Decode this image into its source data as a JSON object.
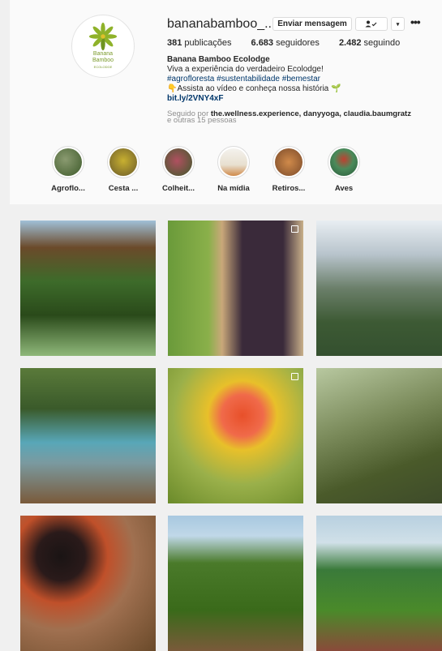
{
  "profile": {
    "username": "bananabamboo_...",
    "logo": {
      "line1": "Banana",
      "line2": "Bamboo",
      "sub": "ECOLODGE"
    },
    "buttons": {
      "message": "Enviar mensagem",
      "follow_icon": "person-check-icon",
      "caret": "▾",
      "more": "•••"
    },
    "stats": [
      {
        "count": "381",
        "label": "publicações"
      },
      {
        "count": "6.683",
        "label": "seguidores"
      },
      {
        "count": "2.482",
        "label": "seguindo"
      }
    ],
    "bio": {
      "name": "Banana Bamboo Ecolodge",
      "line1": "Viva a experiência do verdadeiro Ecolodge!",
      "tags": "#agrofloresta #sustentabilidade #bemestar",
      "line3": "👇Assista ao vídeo e conheça nossa história 🌱",
      "link": "bit.ly/2VNY4xF"
    },
    "followed_by": {
      "prefix": "Seguido por",
      "names": "the.wellness.experience, danyyoga, claudia.baumgratz",
      "suffix": "e outras 15 pessoas"
    }
  },
  "highlights": [
    {
      "label": "Agroflo...",
      "color": "#4d6b3c"
    },
    {
      "label": "Cesta ...",
      "color": "#8a7a2a"
    },
    {
      "label": "Colheit...",
      "color": "#8c3b4a"
    },
    {
      "label": "Na mídia",
      "color": "#e8e4dc"
    },
    {
      "label": "Retiros...",
      "color": "#b06a3a"
    },
    {
      "label": "Aves",
      "color": "#3f7a4a"
    }
  ],
  "posts": [
    {
      "name": "post-treehouse",
      "colors": [
        "#6b4a2a",
        "#3d6b2a",
        "#8fb87a"
      ]
    },
    {
      "name": "post-bananas-tart",
      "colors": [
        "#7aa04a",
        "#3a2a3a",
        "#c9b08a"
      ]
    },
    {
      "name": "post-mountain-valley",
      "colors": [
        "#cfd8de",
        "#6b7f6a",
        "#34502f"
      ]
    },
    {
      "name": "post-pool-deck",
      "colors": [
        "#4a6a3a",
        "#58a7b8",
        "#7a5a3a"
      ]
    },
    {
      "name": "post-oranges",
      "colors": [
        "#e8c02a",
        "#e06a50",
        "#9ab04a"
      ]
    },
    {
      "name": "post-woodpecker",
      "colors": [
        "#7a8a5a",
        "#b8c8a0",
        "#3d4a2a"
      ]
    },
    {
      "name": "post-jams",
      "colors": [
        "#6a4a2a",
        "#c0502a",
        "#2a1a1a"
      ]
    },
    {
      "name": "post-banana-field",
      "colors": [
        "#a8c8e0",
        "#4a7a2a",
        "#7a5a3a"
      ]
    },
    {
      "name": "post-farm-rows",
      "colors": [
        "#b8d0e0",
        "#4a8a2a",
        "#8a4a3a"
      ]
    }
  ]
}
